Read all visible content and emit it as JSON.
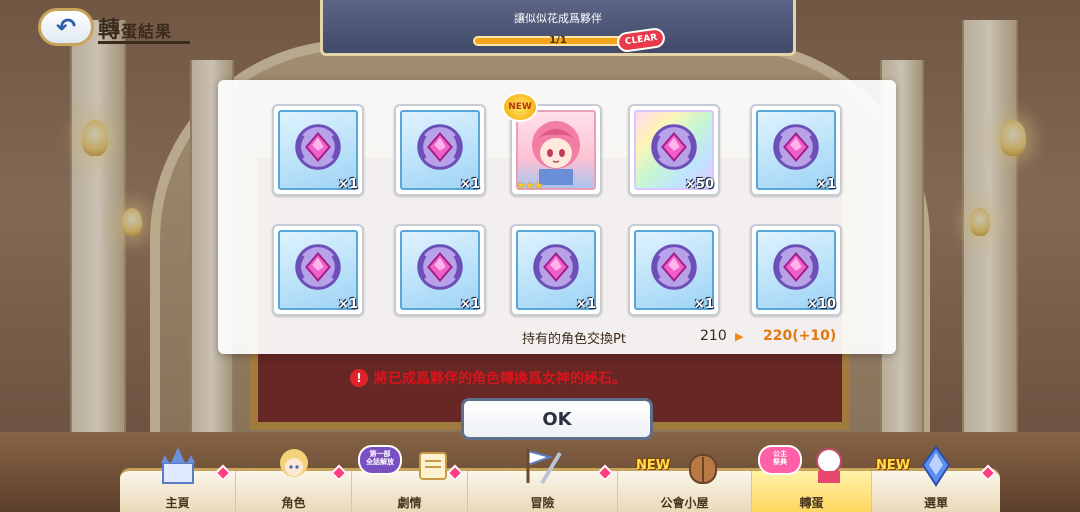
{
  "header": {
    "title_main": "轉",
    "title_rest": "蛋結果"
  },
  "mission": {
    "text": "讓似似花成爲夥伴",
    "progress": "1/1",
    "progress_fraction": 1.0,
    "clear_label": "CLEAR"
  },
  "results": {
    "row1": [
      {
        "type": "gem",
        "qty": "×1"
      },
      {
        "type": "gem",
        "qty": "×1"
      },
      {
        "type": "character",
        "badge": "NEW",
        "stars": "★★★"
      },
      {
        "type": "gem-rainbow",
        "qty": "×50"
      },
      {
        "type": "gem",
        "qty": "×1"
      }
    ],
    "row2": [
      {
        "type": "gem",
        "qty": "×1"
      },
      {
        "type": "gem",
        "qty": "×1"
      },
      {
        "type": "gem",
        "qty": "×1"
      },
      {
        "type": "gem",
        "qty": "×1"
      },
      {
        "type": "gem",
        "qty": "×10"
      }
    ]
  },
  "points": {
    "label": "持有的角色交換Pt",
    "old": "210",
    "arrow": "▶",
    "new": "220(+10)"
  },
  "notice": {
    "icon": "!",
    "text": "將已成爲夥伴的角色轉換爲女神的秘石。"
  },
  "ok_button": "OK",
  "nav": {
    "items": [
      {
        "label": "主頁"
      },
      {
        "label": "角色"
      },
      {
        "label": "劇情",
        "badge": "第一部\n全話解放"
      },
      {
        "label": "冒險"
      },
      {
        "label": "公會小屋",
        "new": "NEW"
      },
      {
        "label": "轉蛋",
        "badge": "公主\n祭典"
      },
      {
        "label": "選單",
        "new": "NEW"
      }
    ]
  },
  "colors": {
    "accent_gold": "#c8a35a",
    "notice_red": "#d8141c",
    "points_orange": "#e07a10",
    "active_tab": "#ffd45a"
  }
}
